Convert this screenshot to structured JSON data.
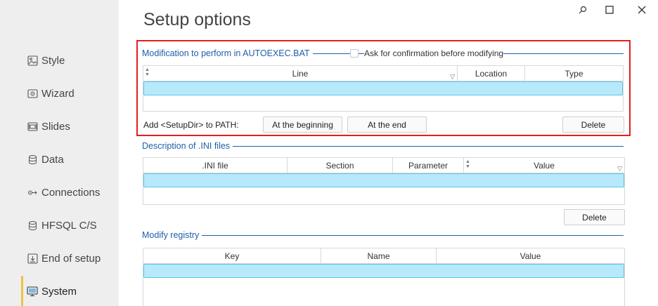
{
  "page": {
    "title": "Setup options"
  },
  "window": {
    "search_glyph": "⚲",
    "maximize_glyph": "☐",
    "close_glyph": "✕"
  },
  "sidebar": {
    "items": [
      {
        "label": "Style",
        "icon": "image-icon"
      },
      {
        "label": "Wizard",
        "icon": "wizard-icon"
      },
      {
        "label": "Slides",
        "icon": "slides-icon"
      },
      {
        "label": "Data",
        "icon": "database-icon"
      },
      {
        "label": "Connections",
        "icon": "connections-icon"
      },
      {
        "label": "HFSQL C/S",
        "icon": "server-icon"
      },
      {
        "label": "End of setup",
        "icon": "end-setup-icon"
      },
      {
        "label": "System",
        "icon": "system-icon"
      }
    ],
    "active": "System",
    "active_color": "#f0c040"
  },
  "autoexec": {
    "heading": "Modification to perform in AUTOEXEC.BAT",
    "confirm_label": "Ask for confirmation before modifying",
    "columns": [
      "Line",
      "Location",
      "Type"
    ],
    "path_label": "Add <SetupDir> to PATH:",
    "btn_beginning": "At the beginning",
    "btn_end": "At the end",
    "btn_delete": "Delete"
  },
  "ini": {
    "heading": "Description of .INI files",
    "columns": [
      ".INI file",
      "Section",
      "Parameter",
      "Value"
    ],
    "btn_delete": "Delete"
  },
  "registry": {
    "heading": "Modify registry",
    "columns": [
      "Key",
      "Name",
      "Value"
    ]
  },
  "colors": {
    "accent": "#1f5fa8",
    "highlight_border": "#e02020",
    "row_selected": "#b7e9fb"
  }
}
